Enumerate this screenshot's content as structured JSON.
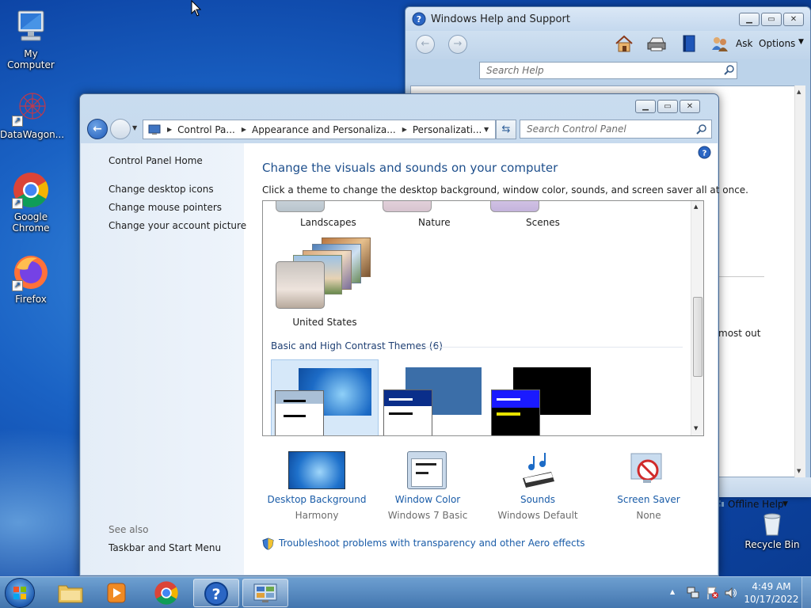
{
  "desktop": {
    "icons": [
      {
        "label": "My Computer"
      },
      {
        "label": "DataWagon..."
      },
      {
        "label": "Google Chrome"
      },
      {
        "label": "Firefox"
      },
      {
        "label": "Recycle Bin"
      }
    ]
  },
  "help_window": {
    "title": "Windows Help and Support",
    "ask_label": "Ask",
    "options_label": "Options",
    "search_placeholder": "Search Help",
    "partial_text": "most out",
    "offline_help_label": "Offline Help"
  },
  "control_panel": {
    "breadcrumbs": [
      "Control Pa...",
      "Appearance and Personaliza...",
      "Personalizati..."
    ],
    "search_placeholder": "Search Control Panel",
    "left_links": [
      "Control Panel Home",
      "Change desktop icons",
      "Change mouse pointers",
      "Change your account picture"
    ],
    "see_also_label": "See also",
    "see_also_links": [
      "Taskbar and Start Menu"
    ],
    "heading": "Change the visuals and sounds on your computer",
    "subtext": "Click a theme to change the desktop background, window color, sounds, and screen saver all at once.",
    "themes_top": [
      "Landscapes",
      "Nature",
      "Scenes"
    ],
    "theme_united_states": "United States",
    "basic_section_title": "Basic and High Contrast Themes (6)",
    "settings": [
      {
        "title": "Desktop Background",
        "value": "Harmony"
      },
      {
        "title": "Window Color",
        "value": "Windows 7 Basic"
      },
      {
        "title": "Sounds",
        "value": "Windows Default"
      },
      {
        "title": "Screen Saver",
        "value": "None"
      }
    ],
    "troubleshoot_link": "Troubleshoot problems with transparency and other Aero effects"
  },
  "taskbar": {
    "time": "4:49 AM",
    "date": "10/17/2022"
  }
}
